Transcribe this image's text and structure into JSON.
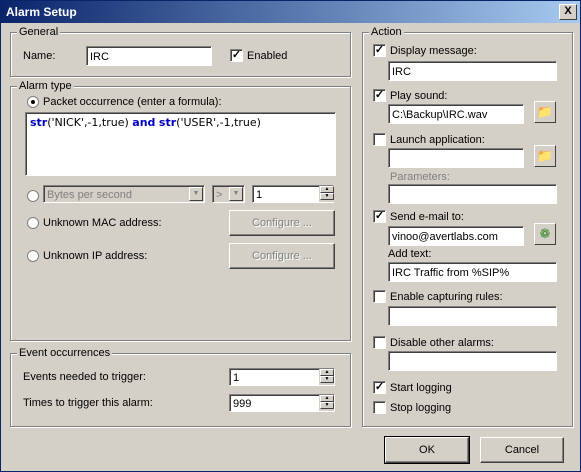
{
  "window": {
    "title": "Alarm Setup",
    "close": "X"
  },
  "general": {
    "legend": "General",
    "name_label": "Name:",
    "name_value": "IRC",
    "enabled_label": "Enabled",
    "enabled_checked": true
  },
  "alarm_type": {
    "legend": "Alarm type",
    "packet_label": "Packet occurrence (enter a formula):",
    "formula": {
      "fn1": "str",
      "arg1": "('NICK',-1,true)",
      "op": "and",
      "fn2": "str",
      "arg2": "('USER',-1,true)"
    },
    "bytes_select": "Bytes per second",
    "comparator": ">",
    "bytes_value": "1",
    "unknown_mac_label": "Unknown MAC address:",
    "unknown_ip_label": "Unknown IP address:",
    "configure_label": "Configure ..."
  },
  "event_occurrences": {
    "legend": "Event occurrences",
    "events_label": "Events needed to trigger:",
    "events_value": "1",
    "times_label": "Times to trigger this alarm:",
    "times_value": "999"
  },
  "action": {
    "legend": "Action",
    "display_message_label": "Display message:",
    "display_message_value": "IRC",
    "play_sound_label": "Play sound:",
    "play_sound_value": "C:\\Backup\\IRC.wav",
    "launch_app_label": "Launch application:",
    "launch_app_value": "",
    "parameters_label": "Parameters:",
    "parameters_value": "",
    "send_email_label": "Send e-mail to:",
    "send_email_value": "vinoo@avertlabs.com",
    "add_text_label": "Add text:",
    "add_text_value": "IRC Traffic from %SIP%",
    "capturing_label": "Enable capturing rules:",
    "capturing_value": "",
    "disable_alarms_label": "Disable other alarms:",
    "disable_alarms_value": "",
    "start_logging_label": "Start logging",
    "stop_logging_label": "Stop logging"
  },
  "buttons": {
    "ok": "OK",
    "cancel": "Cancel"
  }
}
